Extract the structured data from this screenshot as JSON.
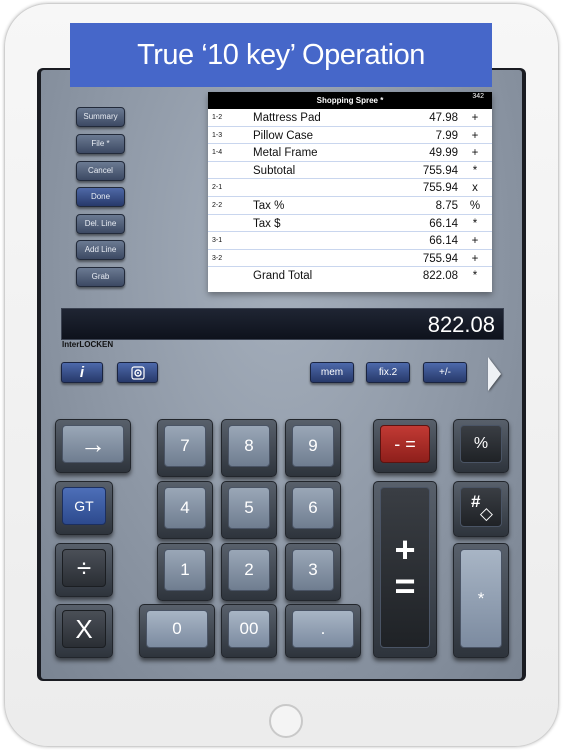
{
  "banner": {
    "title": "True ‘10 key’ Operation"
  },
  "side_buttons": [
    {
      "label": "Summary"
    },
    {
      "label": "File *"
    },
    {
      "label": "Cancel"
    },
    {
      "label": "Done"
    },
    {
      "label": "Del. Line"
    },
    {
      "label": "Add Line"
    },
    {
      "label": "Grab"
    }
  ],
  "tape": {
    "title": "Shopping Spree *",
    "count": "342",
    "rows": [
      {
        "ref": "1-2",
        "label": "Mattress Pad",
        "value": "47.98",
        "op": "+"
      },
      {
        "ref": "1-3",
        "label": "Pillow Case",
        "value": "7.99",
        "op": "+"
      },
      {
        "ref": "1-4",
        "label": "Metal Frame",
        "value": "49.99",
        "op": "+"
      },
      {
        "ref": "",
        "label": "Subtotal",
        "value": "755.94",
        "op": "*"
      },
      {
        "ref": "2-1",
        "label": "",
        "value": "755.94",
        "op": "x"
      },
      {
        "ref": "2-2",
        "label": "Tax %",
        "value": "8.75",
        "op": "%"
      },
      {
        "ref": "",
        "label": "Tax $",
        "value": "66.14",
        "op": "*"
      },
      {
        "ref": "3-1",
        "label": "",
        "value": "66.14",
        "op": "+"
      },
      {
        "ref": "3-2",
        "label": "",
        "value": "755.94",
        "op": "+"
      },
      {
        "ref": "",
        "label": "Grand Total",
        "value": "822.08",
        "op": "*"
      }
    ]
  },
  "display": {
    "value": "822.08"
  },
  "brand": {
    "text": "InterLOCKEN"
  },
  "toolbar": {
    "info_label": "i",
    "settings_icon": "gear-icon",
    "mem_label": "mem",
    "fix_label": "fix.2",
    "sign_label": "+/-"
  },
  "keys": {
    "arrow": "→",
    "gt": "GT",
    "divide": "÷",
    "multiply": "X",
    "k7": "7",
    "k8": "8",
    "k9": "9",
    "k4": "4",
    "k5": "5",
    "k6": "6",
    "k1": "1",
    "k2": "2",
    "k3": "3",
    "k0": "0",
    "k00": "00",
    "dot": ".",
    "minus_eq": "- =",
    "percent": "%",
    "hash": "#",
    "diamond": "◇",
    "plus": "+",
    "equals": "=",
    "star": "*"
  },
  "colors": {
    "banner": "#4667c9",
    "minus_key": "#b0302a",
    "gt_key": "#3d5ea8"
  }
}
